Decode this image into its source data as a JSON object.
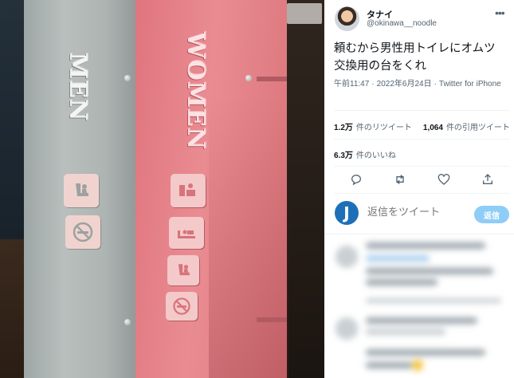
{
  "photo": {
    "men_label": "MEN",
    "women_label": "WOMEN",
    "men_icons": [
      "baby-seat-icon",
      "no-smoking-icon"
    ],
    "women_icons": [
      "nursing-room-icon",
      "diaper-changing-icon",
      "baby-seat-icon",
      "no-smoking-icon"
    ],
    "colors": {
      "men_panel": "#b4bab8",
      "women_panel": "#e4828a"
    }
  },
  "tweet": {
    "display_name": "タナイ",
    "handle": "@okinawa__noodle",
    "text_line1": "頼むから男性用トイレにオムツ",
    "text_line2": "交換用の台をくれ",
    "time": "午前11:47",
    "date": "2022年6月24日",
    "source": "Twitter for iPhone",
    "retweets_count": "1.2万",
    "retweets_label": "件のリツイート",
    "quotes_count": "1,064",
    "quotes_label": "件の引用ツイート",
    "likes_count": "6.3万",
    "likes_label": "件のいいね",
    "actions": [
      "reply-icon",
      "retweet-icon",
      "like-icon",
      "share-icon"
    ],
    "reply_avatar_letter": "J",
    "reply_placeholder": "返信をツイート",
    "reply_button": "返信",
    "colors": {
      "accent": "#1d9bf0",
      "reply_button": "#8ecdf8"
    }
  }
}
